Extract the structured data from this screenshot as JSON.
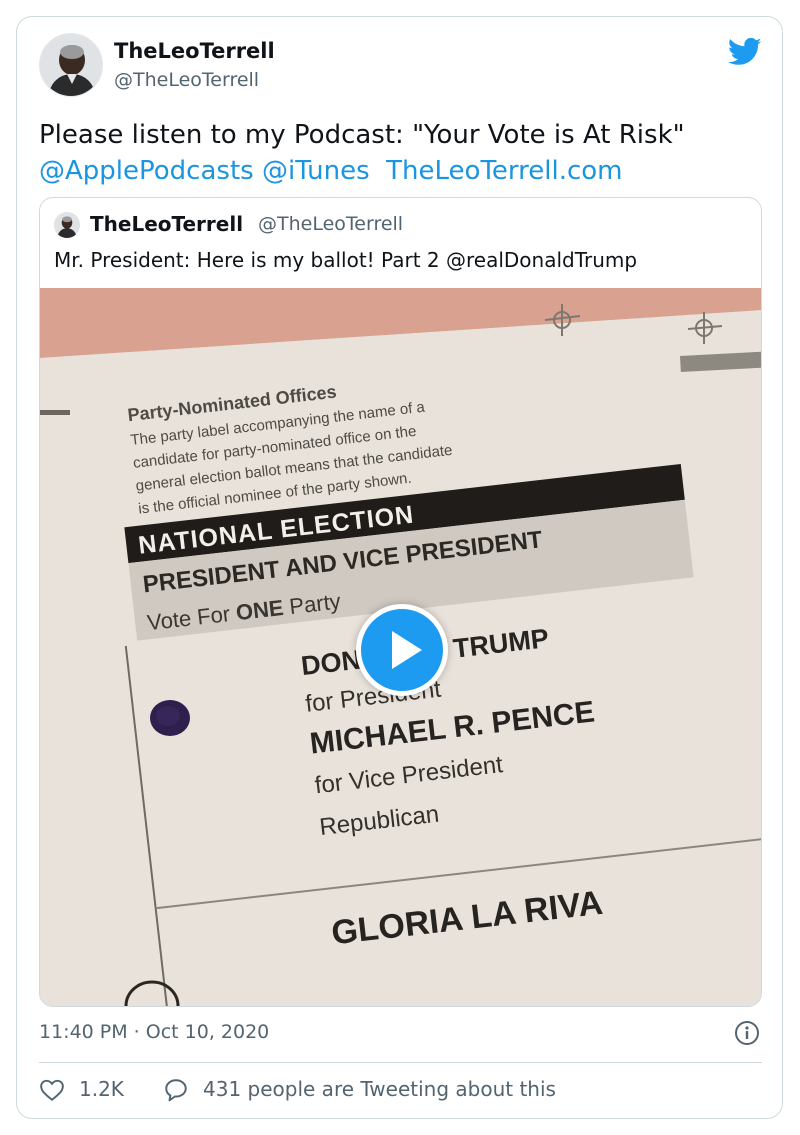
{
  "author": {
    "name": "TheLeoTerrell",
    "handle": "@TheLeoTerrell"
  },
  "tweet": {
    "text": "Please listen to my Podcast: \"Your Vote is At Risk\"",
    "links": [
      "@ApplePodcasts",
      "@iTunes",
      "TheLeoTerrell.com"
    ]
  },
  "quoted_tweet": {
    "name": "TheLeoTerrell",
    "handle": "@TheLeoTerrell",
    "text": "Mr. President: Here is my ballot! Part 2 @realDonaldTrump",
    "media": {
      "heading": "Party-Nominated Offices",
      "description_lines": [
        "The party label accompanying the name of a",
        "candidate for party-nominated office on the",
        "general election ballot means that the candidate",
        "is the official nominee of the party shown."
      ],
      "banner": "NATIONAL ELECTION",
      "race": "PRESIDENT AND VICE PRESIDENT",
      "vote_for_prefix": "Vote For ",
      "vote_for_bold": "ONE",
      "vote_for_suffix": " Party",
      "candidate1": "DONALD J. TRUMP",
      "candidate1_role": "for President",
      "candidate2": "MICHAEL R. PENCE",
      "candidate2_role": "for Vice President",
      "party": "Republican",
      "candidate3": "GLORIA LA RIVA"
    }
  },
  "meta": {
    "timestamp": "11:40 PM · Oct 10, 2020",
    "likes": "1.2K",
    "replies_text": "431 people are Tweeting about this"
  },
  "colors": {
    "brand": "#1d9bf0",
    "link": "#1b95e0",
    "secondary_text": "#536471",
    "border": "#cfd9de"
  },
  "icons": [
    "twitter-bird-icon",
    "play-icon",
    "info-icon",
    "heart-icon",
    "speech-bubble-icon"
  ]
}
